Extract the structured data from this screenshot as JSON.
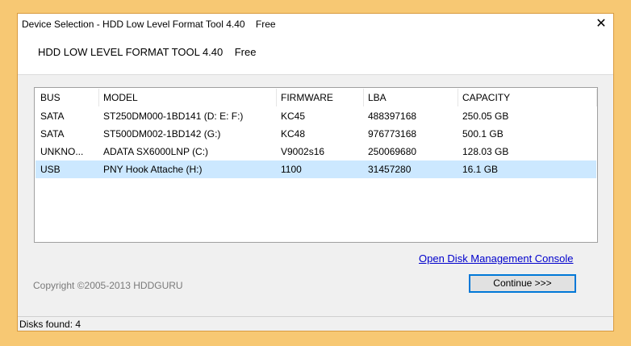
{
  "window": {
    "title": "Device Selection - HDD Low Level Format Tool 4.40    Free",
    "close_glyph": "✕"
  },
  "header": {
    "title": "HDD LOW LEVEL FORMAT TOOL 4.40    Free"
  },
  "table": {
    "columns": [
      "BUS",
      "MODEL",
      "FIRMWARE",
      "LBA",
      "CAPACITY"
    ],
    "rows": [
      [
        "SATA",
        "ST250DM000-1BD141 (D: E: F:)",
        "KC45",
        "488397168",
        "250.05 GB"
      ],
      [
        "SATA",
        "ST500DM002-1BD142 (G:)",
        "KC48",
        "976773168",
        "500.1 GB"
      ],
      [
        "UNKNO...",
        "ADATA SX6000LNP (C:)",
        "V9002s16",
        "250069680",
        "128.03 GB"
      ],
      [
        "USB",
        "PNY Hook Attache (H:)",
        "1100",
        "31457280",
        "16.1 GB"
      ]
    ],
    "selected_row": 3
  },
  "link": {
    "label": "Open Disk Management Console"
  },
  "copyright": "Copyright ©2005-2013 HDDGURU",
  "continue_button": {
    "label": "Continue >>>"
  },
  "status": {
    "text": "Disks found: 4"
  }
}
